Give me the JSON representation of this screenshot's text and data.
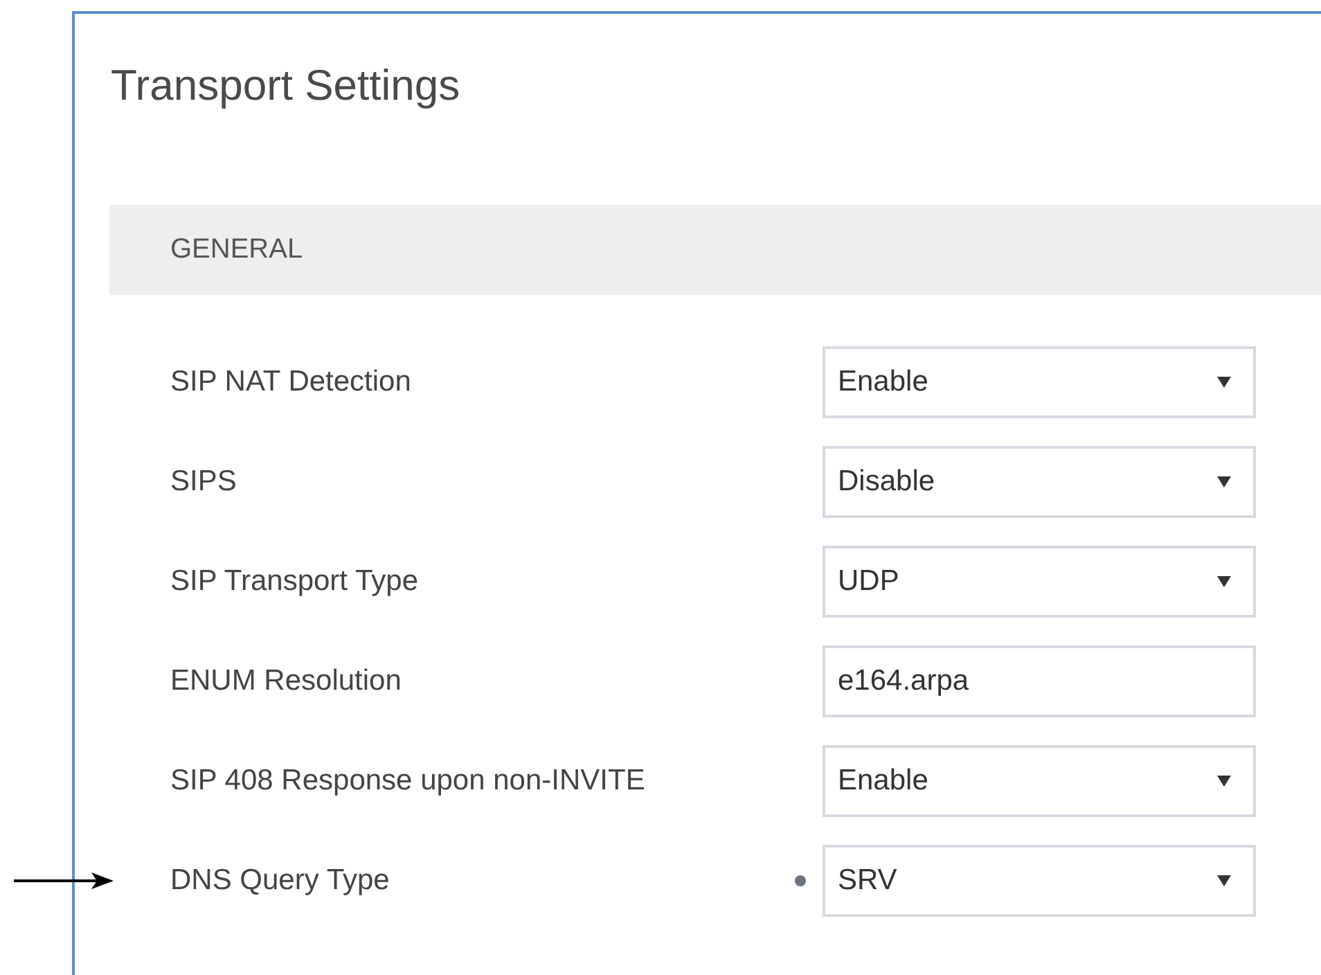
{
  "page": {
    "title": "Transport Settings"
  },
  "section": {
    "title": "GENERAL"
  },
  "rows": [
    {
      "label": "SIP NAT Detection",
      "kind": "select",
      "value": "Enable",
      "changed": false,
      "pointed": false
    },
    {
      "label": "SIPS",
      "kind": "select",
      "value": "Disable",
      "changed": false,
      "pointed": false
    },
    {
      "label": "SIP Transport Type",
      "kind": "select",
      "value": "UDP",
      "changed": false,
      "pointed": false
    },
    {
      "label": "ENUM Resolution",
      "kind": "text",
      "value": "e164.arpa",
      "changed": false,
      "pointed": false
    },
    {
      "label": "SIP 408 Response upon non-INVITE",
      "kind": "select",
      "value": "Enable",
      "changed": false,
      "pointed": false
    },
    {
      "label": "DNS Query Type",
      "kind": "select",
      "value": "SRV",
      "changed": true,
      "pointed": true
    }
  ]
}
